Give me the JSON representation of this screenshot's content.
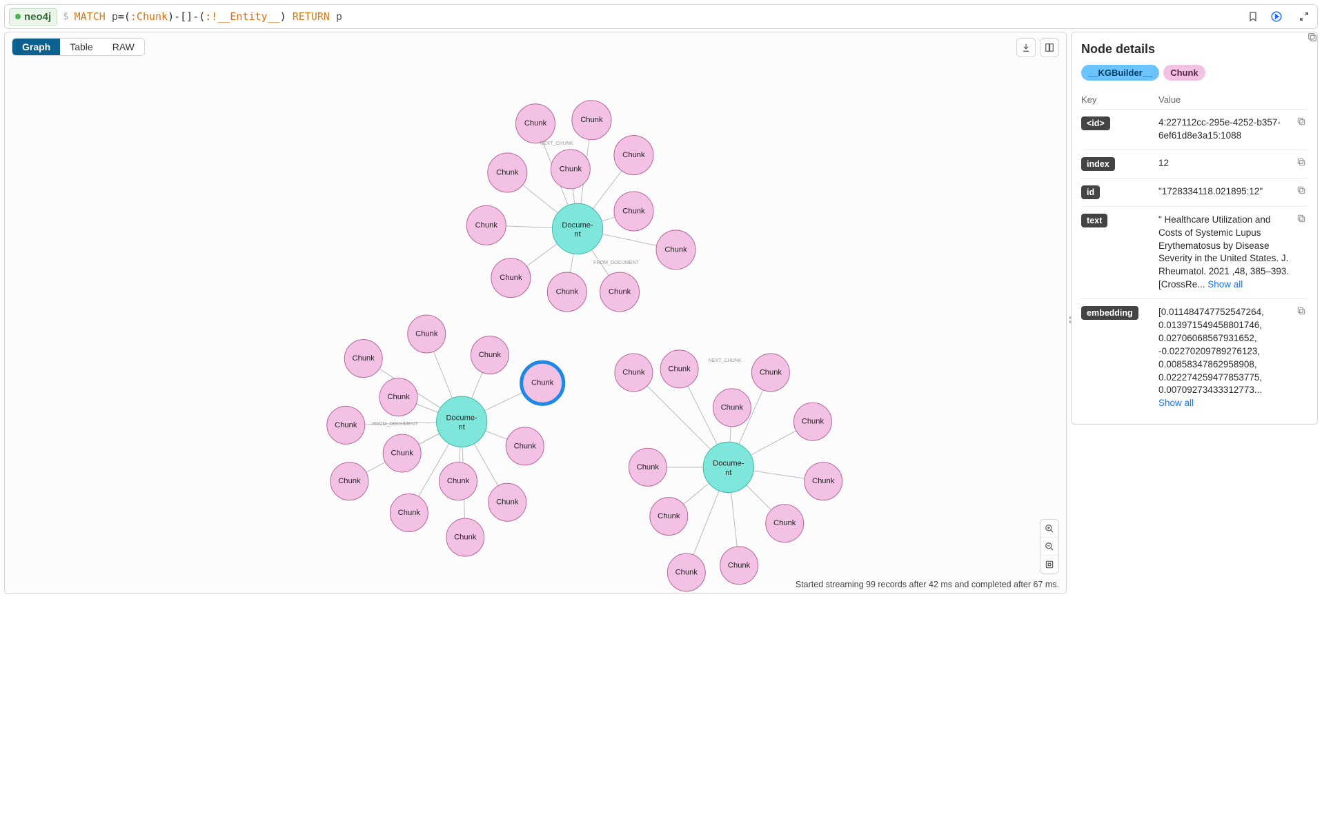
{
  "db_badge": "neo4j",
  "prompt": "$",
  "query_parts": {
    "match": "MATCH",
    "p": "p",
    "eq": "=(",
    "label1": ":Chunk",
    "mid": ")-[]-(",
    "label2": ":!__Entity__",
    "close": ") ",
    "return": "RETURN",
    "p2": " p"
  },
  "tabs": {
    "graph": "Graph",
    "table": "Table",
    "raw": "RAW"
  },
  "graph": {
    "doc_label1": "Docume-",
    "doc_label2": "nt",
    "chunk_label": "Chunk",
    "edge_from": "FROM_DOCUMENT",
    "edge_next": "NEXT_CHUNK"
  },
  "status": "Started streaming 99 records after 42 ms and completed after 67 ms.",
  "details": {
    "title": "Node details",
    "chips": {
      "kg": "__KGBuilder__",
      "chunk": "Chunk"
    },
    "head_key": "Key",
    "head_val": "Value",
    "rows": {
      "id_key": "<id>",
      "id_val": "4:227112cc-295e-4252-b357-6ef61d8e3a15:1088",
      "index_key": "index",
      "index_val": "12",
      "id2_key": "id",
      "id2_val": "\"1728334118.021895:12\"",
      "text_key": "text",
      "text_val": "\" Healthcare Utilization and Costs of Systemic Lupus Erythematosus by Disease Severity in the United States. J. Rheumatol. 2021 ,48, 385–393.\n[CrossRe... ",
      "text_show": "Show all",
      "emb_key": "embedding",
      "emb_val": "[0.011484747752547264, 0.013971549458801746, 0.02706068567931652, -0.02270209789276123, 0.00858347862958908, 0.022274259477853775, 0.00709273433312773...",
      "emb_show": "Show all"
    }
  }
}
